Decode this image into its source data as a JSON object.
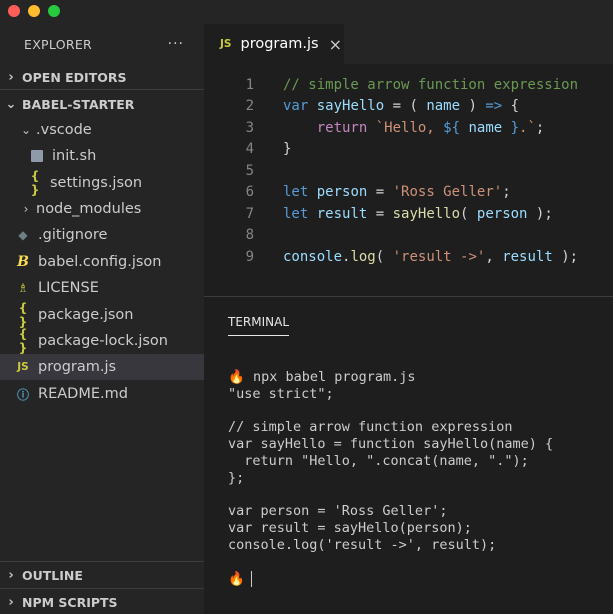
{
  "sidebar": {
    "title": "EXPLORER",
    "more": "···",
    "open_editors": "OPEN EDITORS",
    "project": "BABEL-STARTER",
    "items": [
      {
        "label": ".vscode",
        "icon": "chevron-down-icon"
      },
      {
        "label": "init.sh",
        "icon": "shell-file-icon"
      },
      {
        "label": "settings.json",
        "icon": "json-file-icon"
      },
      {
        "label": "node_modules",
        "icon": "chevron-right-icon"
      },
      {
        "label": ".gitignore",
        "icon": "git-icon"
      },
      {
        "label": "babel.config.json",
        "icon": "babel-icon"
      },
      {
        "label": "LICENSE",
        "icon": "license-icon"
      },
      {
        "label": "package.json",
        "icon": "json-file-icon"
      },
      {
        "label": "package-lock.json",
        "icon": "json-file-icon"
      },
      {
        "label": "program.js",
        "icon": "js-file-icon"
      },
      {
        "label": "README.md",
        "icon": "info-icon"
      }
    ],
    "outline": "OUTLINE",
    "npm_scripts": "NPM SCRIPTS"
  },
  "tab": {
    "badge": "JS",
    "label": "program.js",
    "close": "×"
  },
  "json_badge": "{ }",
  "js_badge": "JS",
  "code_lines": [
    "1",
    "2",
    "3",
    "4",
    "5",
    "6",
    "7",
    "8",
    "9"
  ],
  "code": {
    "l1": "// simple arrow function expression",
    "l2_kw": "var",
    "l2_var": "sayHello",
    "l2_a": " = ( ",
    "l2_param": "name",
    "l2_b": " ) ",
    "l2_arrow": "=>",
    "l2_c": " {",
    "l3_ret": "return",
    "l3_str1": "`Hello, ",
    "l3_interp1": "${",
    "l3_var": " name ",
    "l3_interp2": "}",
    "l3_str2": ".`",
    "l3_end": ";",
    "l4": "}",
    "l6_kw": "let",
    "l6_var": "person",
    "l6_eq": " = ",
    "l6_str": "'Ross Geller'",
    "l6_end": ";",
    "l7_kw": "let",
    "l7_var": "result",
    "l7_eq": " = ",
    "l7_fn": "sayHello",
    "l7_a": "( ",
    "l7_arg": "person",
    "l7_b": " );",
    "l9_obj": "console",
    "l9_dot": ".",
    "l9_fn": "log",
    "l9_a": "( ",
    "l9_str": "'result ->'",
    "l9_c": ", ",
    "l9_arg": "result",
    "l9_b": " );"
  },
  "terminal": {
    "tab": "TERMINAL",
    "prompt_icon": "🔥",
    "lines": [
      " npx babel program.js",
      "\"use strict\";",
      "",
      "// simple arrow function expression",
      "var sayHello = function sayHello(name) {",
      "  return \"Hello, \".concat(name, \".\");",
      "};",
      "",
      "var person = 'Ross Geller';",
      "var result = sayHello(person);",
      "console.log('result ->', result);",
      ""
    ]
  }
}
